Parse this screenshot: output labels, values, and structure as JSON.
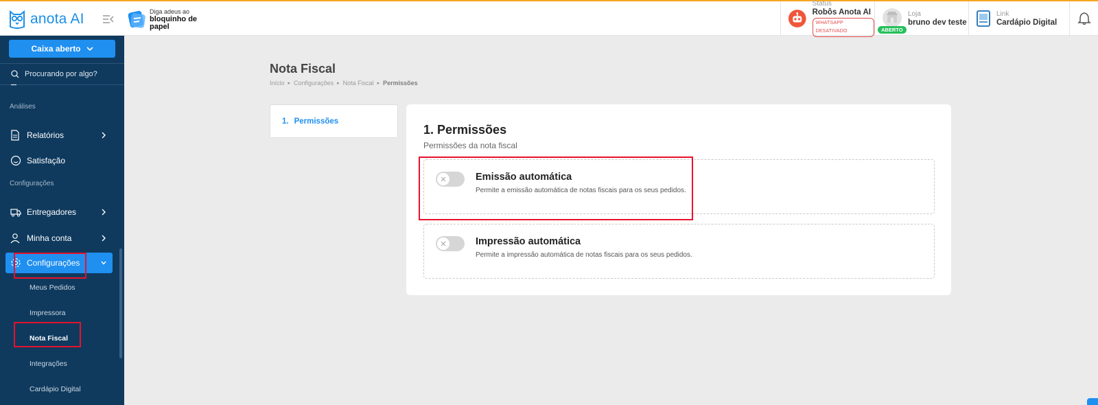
{
  "header": {
    "logo_text": "anota AI",
    "promo": {
      "line1": "Diga adeus ao",
      "line2": "bloquinho de",
      "line3": "papel"
    },
    "status": {
      "label": "Status",
      "value": "Robôs Anota AI",
      "badge": "WHATSAPP DESATIVADO"
    },
    "loja": {
      "label": "Loja",
      "value": "bruno dev teste",
      "badge": "ABERTO"
    },
    "link": {
      "label": "Link",
      "value": "Cardápio Digital"
    }
  },
  "sidebar": {
    "caixa_label": "Caixa aberto",
    "search_placeholder": "Procurando por algo?",
    "section_analises": "Análises",
    "relatorios": "Relatórios",
    "satisfacao": "Satisfação",
    "section_configuracoes": "Configurações",
    "entregadores": "Entregadores",
    "minha_conta": "Minha conta",
    "configuracoes": "Configurações",
    "sub": {
      "meus_pedidos": "Meus Pedidos",
      "impressora": "Impressora",
      "nota_fiscal": "Nota Fiscal",
      "integracoes": "Integrações",
      "cardapio_digital": "Cardápio Digital"
    }
  },
  "main": {
    "title": "Nota Fiscal",
    "breadcrumb": [
      "Início",
      "Configurações",
      "Nota Fiscal",
      "Permissões"
    ],
    "steps": [
      {
        "number": "1.",
        "label": "Permissões"
      }
    ],
    "section": {
      "title": "1. Permissões",
      "subtitle": "Permissões da nota fiscal",
      "options": [
        {
          "title": "Emissão automática",
          "description": "Permite a emissão automática de notas fiscais para os seus pedidos.",
          "enabled": false
        },
        {
          "title": "Impressão automática",
          "description": "Permite a impressão automática de notas fiscais para os seus pedidos.",
          "enabled": false
        }
      ]
    }
  },
  "colors": {
    "primary": "#1f8ff0",
    "sidebar_bg": "#0f3a5e",
    "highlight": "#e8112d",
    "open_badge": "#27c05c",
    "top_accent": "#f5a623"
  }
}
